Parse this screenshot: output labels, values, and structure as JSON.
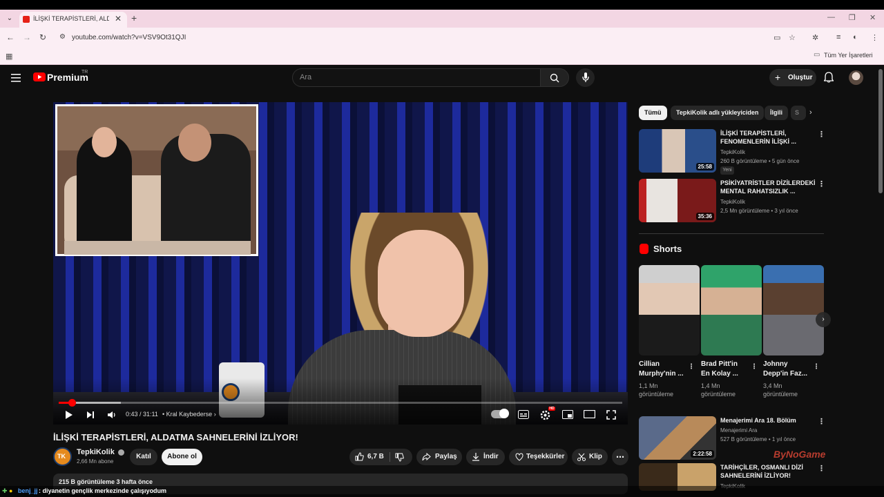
{
  "browser": {
    "tab_title": "İLİŞKİ TERAPİSTLERİ, ALDATMA SAHNELERİNİ İZLİYOR!",
    "url": "youtube.com/watch?v=VSV9Ot31QJI",
    "bookmarks_label": "Tüm Yer İşaretleri"
  },
  "header": {
    "logo_text": "Premium",
    "logo_region": "TR",
    "search_placeholder": "Ara",
    "create_label": "Oluştur"
  },
  "player": {
    "time_display": "0:43 / 31:11",
    "chapter": "• Kral Kaybederse",
    "progress": 0.023,
    "buffered": 0.11,
    "hd_badge": "HD"
  },
  "video": {
    "title": "İLİŞKİ TERAPİSTLERİ, ALDATMA SAHNELERİNİ İZLİYOR!",
    "channel": "TepkiKolik",
    "channel_initials": "TK",
    "subscribers": "2,66 Mn abone",
    "join_label": "Katıl",
    "subscribe_label": "Abone ol",
    "likes": "6,7 B",
    "share_label": "Paylaş",
    "download_label": "İndir",
    "thanks_label": "Teşekkürler",
    "clip_label": "Klip",
    "views_date": "215 B görüntüleme  3 hafta önce"
  },
  "chips": [
    "Tümü",
    "TepkiKolik adlı yükleyiciden",
    "İlgili",
    "S"
  ],
  "related": [
    {
      "title": "İLİŞKİ TERAPİSTLERİ, FENOMENLERİN İLİŞKİ ...",
      "channel": "TepkiKolik",
      "meta": "260 B görüntüleme • 5 gün önce",
      "badge": "Yeni",
      "duration": "25:58"
    },
    {
      "title": "PSİKİYATRİSTLER DİZİLERDEKİ MENTAL RAHATSIZLIK ...",
      "channel": "TepkiKolik",
      "meta": "2,5 Mn görüntüleme • 3 yıl önce",
      "duration": "35:36"
    },
    {
      "title": "Menajerimi Ara 18. Bölüm",
      "channel": "Menajerimi Ara",
      "meta": "527 B görüntüleme • 1 yıl önce",
      "duration": "2:22:58"
    },
    {
      "title": "TARİHÇİLER, OSMANLI DİZİ SAHNELERİNİ İZLİYOR!",
      "channel": "TepkiKolik",
      "meta": ""
    }
  ],
  "shorts": {
    "title": "Shorts",
    "items": [
      {
        "title": "Cillian Murphy'nin ...",
        "views": "1,1 Mn görüntüleme"
      },
      {
        "title": "Brad Pitt'in En Kolay ...",
        "views": "1,4 Mn görüntüleme"
      },
      {
        "title": "Johnny Depp'in Faz...",
        "views": "3,4 Mn görüntüleme"
      }
    ]
  },
  "overlay": {
    "user": "benj_jj",
    "message": ": diyanetin gençlik merkezinde çalışıyodum"
  },
  "watermark": "ByNoGame",
  "colors": {
    "accent": "#ff0000",
    "background": "#0f0f0f",
    "surface": "#272727"
  }
}
